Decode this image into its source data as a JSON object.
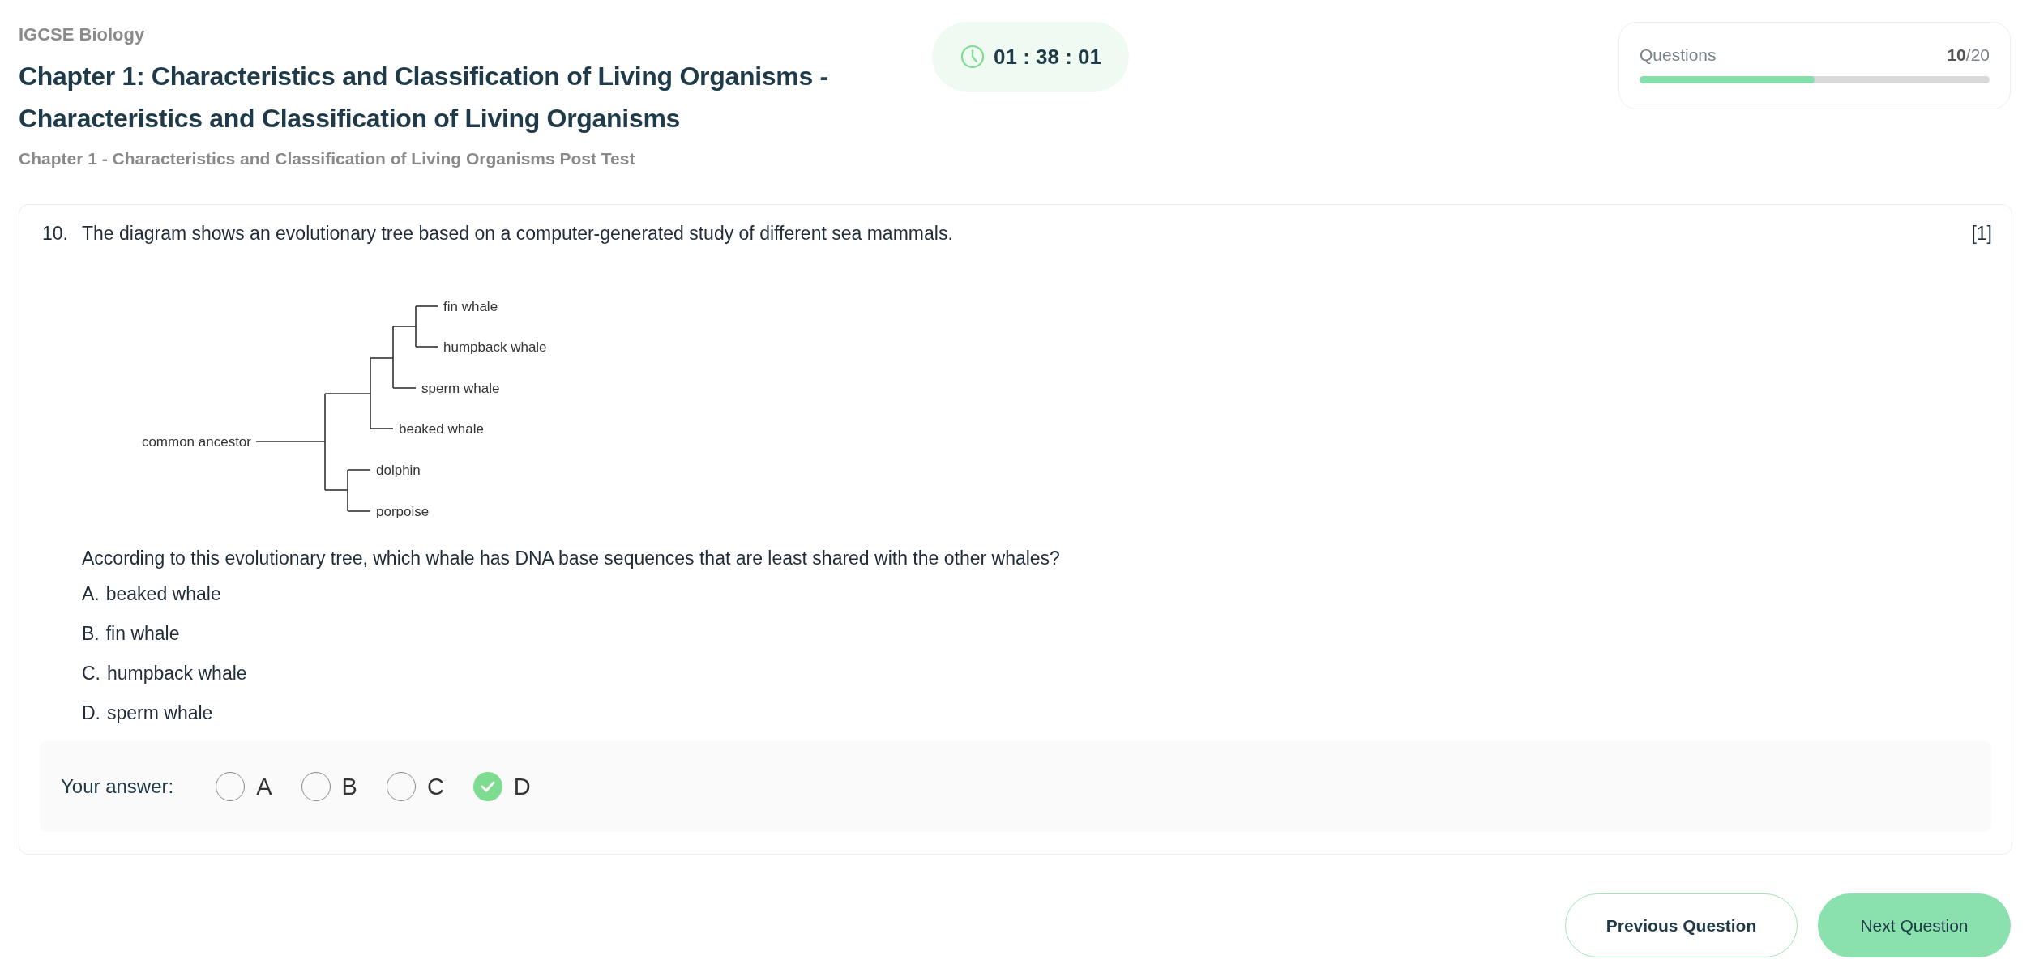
{
  "header": {
    "subject": "IGCSE Biology",
    "title": "Chapter 1: Characteristics and Classification of Living Organisms - Characteristics and Classification of Living Organisms",
    "subtitle": "Chapter 1 - Characteristics and Classification of Living Organisms Post Test"
  },
  "timer": {
    "time": "01 : 38 : 01"
  },
  "progress": {
    "label": "Questions",
    "count": "**10**/20",
    "level": 0.5
  },
  "question": {
    "number": "10.",
    "text": "The diagram shows an evolutionary tree based on a computer-generated study of different sea mammals.",
    "marks": "[1]",
    "diagram": {
      "root": "common ancestor",
      "leaves": [
        "fin whale",
        "humpback whale",
        "sperm whale",
        "beaked whale",
        "dolphin",
        "porpoise"
      ]
    },
    "prompt": "According to this evolutionary tree, which whale has DNA base sequences that are least shared with the other whales?",
    "options": [
      {
        "letter": "A.",
        "text": "beaked whale"
      },
      {
        "letter": "B.",
        "text": "fin whale"
      },
      {
        "letter": "C.",
        "text": "humpback whale"
      },
      {
        "letter": "D.",
        "text": "sperm whale"
      }
    ],
    "answer_label": "Your answer:",
    "choices": [
      {
        "label": "A",
        "selected": false
      },
      {
        "label": "B",
        "selected": false
      },
      {
        "label": "C",
        "selected": false
      },
      {
        "label": "D",
        "selected": true
      }
    ]
  },
  "buttons": [
    {
      "label": "Previous Question",
      "kind": "outline"
    },
    {
      "label": "Next Question",
      "kind": "filled"
    }
  ]
}
